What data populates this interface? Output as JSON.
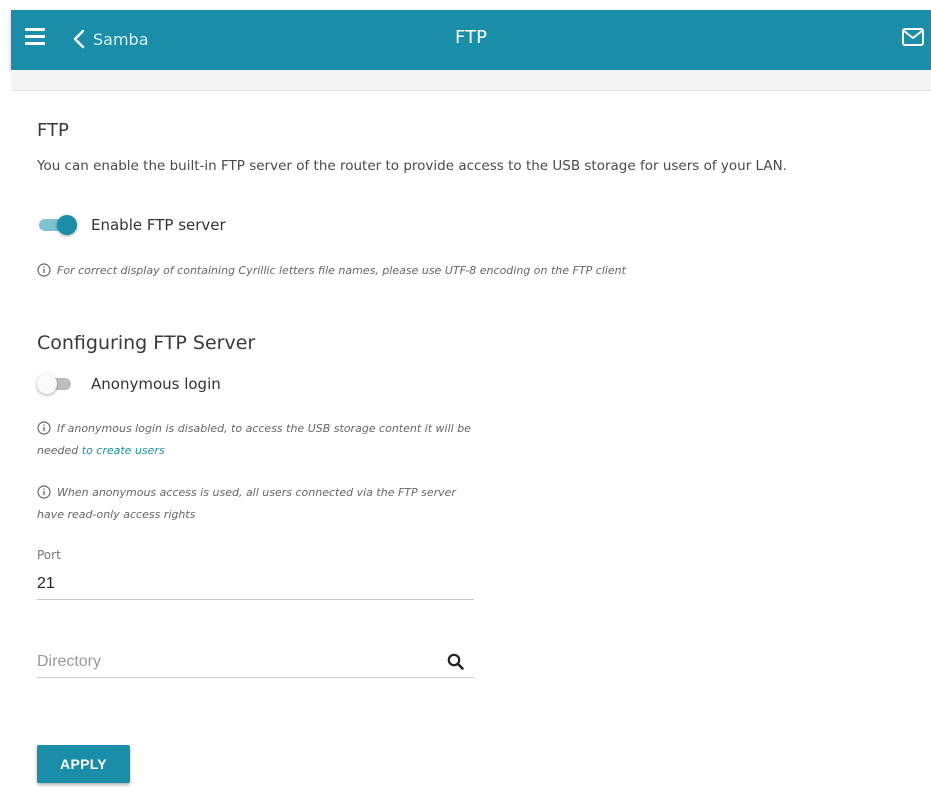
{
  "header": {
    "menu_icon": "hamburger-menu-icon",
    "back_label": "Samba",
    "title": "FTP",
    "mail_icon": "envelope-icon",
    "color": "#1a8ea9"
  },
  "section_ftp": {
    "heading": "FTP",
    "description": "You can enable the built-in FTP server of the router to provide access to the USB storage for users of your LAN.",
    "enable_label": "Enable FTP server",
    "enable_state": true,
    "cyrillic_hint": "For correct display of containing Cyrillic letters file names, please use UTF-8 encoding on the FTP client"
  },
  "section_config": {
    "heading": "Configuring FTP Server",
    "anonymous_label": "Anonymous login",
    "anonymous_state": false,
    "hint_disabled_line1": "If anonymous login is disabled, to access the USB storage content it will be",
    "hint_disabled_line2_prefix": "needed",
    "hint_disabled_link": "to create users",
    "hint_readonly_line1": "When anonymous access is used, all users connected via the FTP server",
    "hint_readonly_line2": "have read-only access rights",
    "port_label": "Port",
    "port_value": "21",
    "directory_placeholder": "Directory"
  },
  "actions": {
    "apply_label": "APPLY"
  }
}
